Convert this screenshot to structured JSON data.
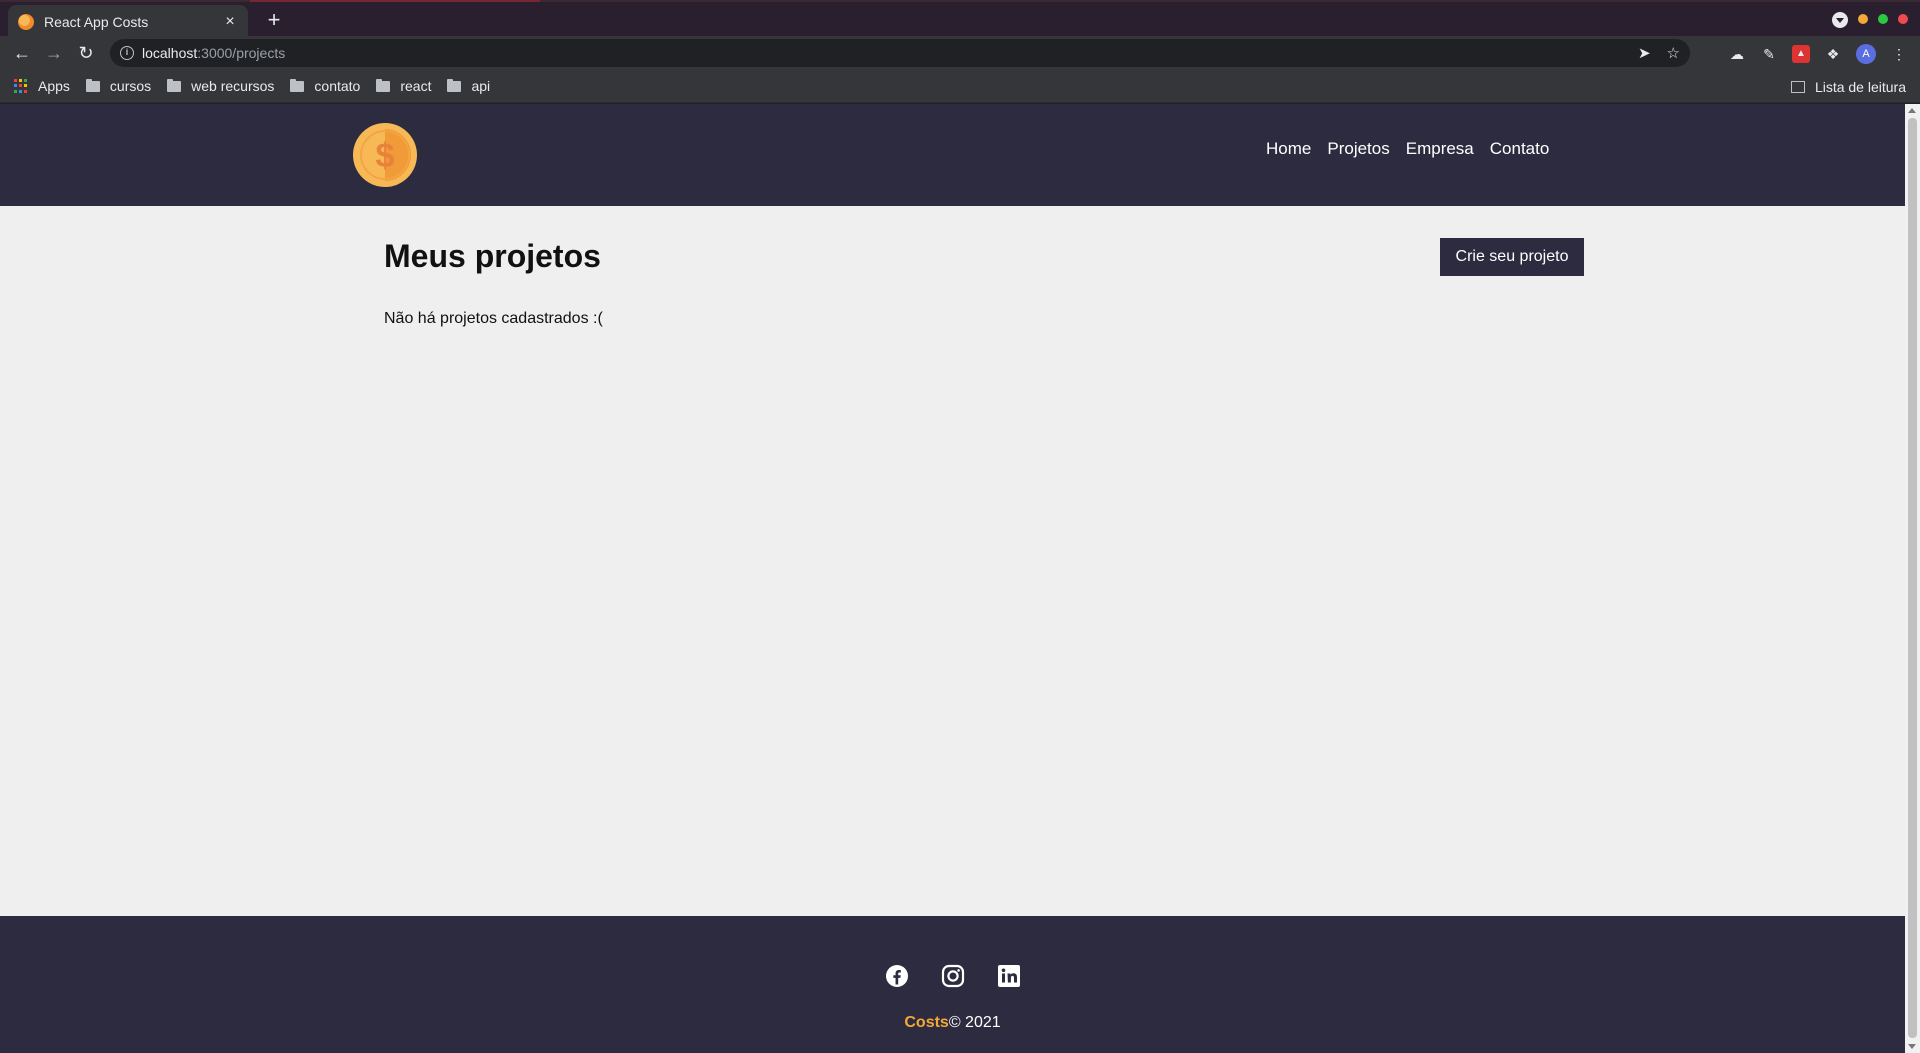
{
  "browser": {
    "tab_title": "React App Costs",
    "tab_close": "×",
    "new_tab": "+",
    "url_host": "localhost",
    "url_path": ":3000/projects",
    "bookmarks": [
      {
        "label": "Apps",
        "icon": "apps-grid-icon"
      },
      {
        "label": "cursos",
        "icon": "folder-icon"
      },
      {
        "label": "web recursos",
        "icon": "folder-icon"
      },
      {
        "label": "contato",
        "icon": "folder-icon"
      },
      {
        "label": "react",
        "icon": "folder-icon"
      },
      {
        "label": "api",
        "icon": "folder-icon"
      }
    ],
    "reading_list": "Lista de leitura",
    "profile_initial": "A",
    "window_colors": [
      "#f4a836",
      "#2bc840",
      "#ef4a52"
    ]
  },
  "navbar": {
    "links": [
      "Home",
      "Projetos",
      "Empresa",
      "Contato"
    ],
    "logo_icon": "coin-dollar-icon",
    "logo_symbol": "$"
  },
  "main": {
    "title": "Meus projetos",
    "new_project_button": "Crie seu projeto",
    "empty_message": "Não há projetos cadastrados :("
  },
  "footer": {
    "social": [
      "facebook-icon",
      "instagram-icon",
      "linkedin-icon"
    ],
    "brand": "Costs",
    "copyright": "© 2021"
  },
  "colors": {
    "navbar_bg": "#2c2b3f",
    "page_bg": "#efefef",
    "brand_accent": "#f4a836"
  }
}
